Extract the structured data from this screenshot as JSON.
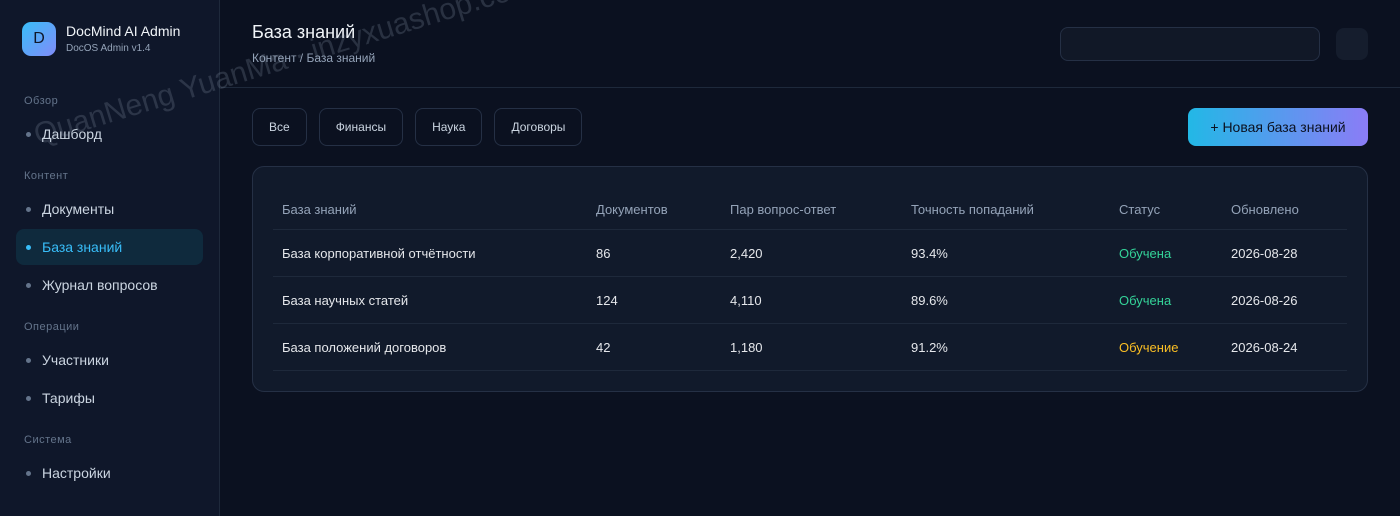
{
  "brand": {
    "logo_letter": "D",
    "title": "DocMind AI Admin",
    "subtitle": "DocOS Admin v1.4"
  },
  "sidebar": {
    "sections": [
      {
        "label": "Обзор",
        "items": [
          {
            "label": "Дашборд",
            "active": false
          }
        ]
      },
      {
        "label": "Контент",
        "items": [
          {
            "label": "Документы",
            "active": false
          },
          {
            "label": "База знаний",
            "active": true
          },
          {
            "label": "Журнал вопросов",
            "active": false
          }
        ]
      },
      {
        "label": "Операции",
        "items": [
          {
            "label": "Участники",
            "active": false
          },
          {
            "label": "Тарифы",
            "active": false
          }
        ]
      },
      {
        "label": "Система",
        "items": [
          {
            "label": "Настройки",
            "active": false
          }
        ]
      }
    ]
  },
  "header": {
    "title": "База знаний",
    "breadcrumb": "Контент / База знаний",
    "search": {
      "value": "",
      "placeholder": ""
    }
  },
  "filters": [
    "Все",
    "Финансы",
    "Наука",
    "Договоры"
  ],
  "new_button_label": "+ Новая база знаний",
  "table": {
    "columns": [
      "База знаний",
      "Документов",
      "Пар вопрос-ответ",
      "Точность попаданий",
      "Статус",
      "Обновлено"
    ],
    "rows": [
      {
        "name": "База корпоративной отчётности",
        "docs": "86",
        "qa_pairs": "2,420",
        "accuracy": "93.4%",
        "status": "Обучена",
        "status_kind": "ok",
        "updated": "2026-08-28"
      },
      {
        "name": "База научных статей",
        "docs": "124",
        "qa_pairs": "4,110",
        "accuracy": "89.6%",
        "status": "Обучена",
        "status_kind": "ok",
        "updated": "2026-08-26"
      },
      {
        "name": "База положений договоров",
        "docs": "42",
        "qa_pairs": "1,180",
        "accuracy": "91.2%",
        "status": "Обучение",
        "status_kind": "training",
        "updated": "2026-08-24"
      }
    ]
  },
  "watermark": "QuanNeng YuanMa · inzyxuashop.com",
  "colors": {
    "accent": "#38bdf8",
    "status_ok": "#34d399",
    "status_training": "#fbbf24",
    "background": "#0b1120"
  }
}
